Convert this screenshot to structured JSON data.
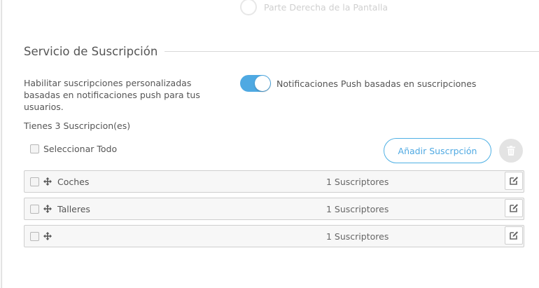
{
  "top_option": {
    "label": "Parte Derecha de la Pantalla"
  },
  "section": {
    "title": "Servicio de Suscripción"
  },
  "push_setting": {
    "description": "Habilitar suscripciones personalizadas basadas en notificaciones push para tus usuarios.",
    "toggle_label": "Notificaciones Push basadas en suscripciones",
    "enabled": true
  },
  "subscriptions": {
    "count_text": "Tienes 3 Suscripcion(es)",
    "select_all_label": "Seleccionar Todo",
    "add_button_label": "Añadir Suscrpción",
    "items": [
      {
        "name": "Coches",
        "subscribers": "1 Suscriptores"
      },
      {
        "name": "Talleres",
        "subscribers": "1 Suscriptores"
      },
      {
        "name": "",
        "subscribers": "1 Suscriptores"
      }
    ]
  },
  "colors": {
    "accent": "#4fa9e2",
    "text": "#555555",
    "row_background": "#f7f7f7",
    "delete_button": "#e3e3e3"
  },
  "icons": {
    "drag": "move-arrows-icon",
    "edit": "edit-icon",
    "delete": "trash-icon"
  }
}
